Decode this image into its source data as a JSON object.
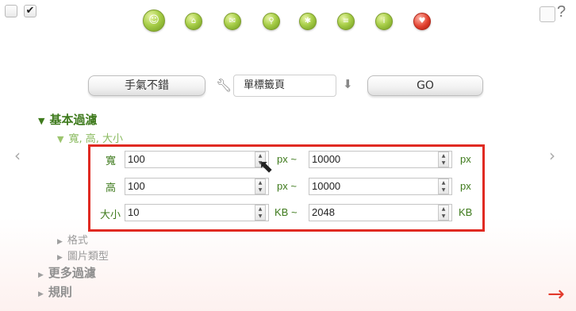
{
  "topbar": {
    "checkbox_unchecked": "",
    "checkbox_checked": "✔",
    "icons": [
      "smiley-icon",
      "home-icon",
      "mail-icon",
      "search-icon",
      "gear-icon",
      "list-icon",
      "info-icon",
      "heart-icon"
    ],
    "help": "?"
  },
  "toolbar": {
    "left_button": "手氣不錯",
    "middle_field": "單標籤頁",
    "right_button": "GO"
  },
  "tree": {
    "basic_filter": "基本過濾",
    "size_section": "寬, 高, 大小",
    "format": "格式",
    "image_type": "圖片類型",
    "more_filters": "更多過濾",
    "rules": "規則"
  },
  "filters": {
    "width": {
      "label": "寬",
      "min": "100",
      "max": "10000",
      "unit_min": "px ~",
      "unit_max": "px"
    },
    "height": {
      "label": "高",
      "min": "100",
      "max": "10000",
      "unit_min": "px ~",
      "unit_max": "px"
    },
    "size": {
      "label": "大小",
      "min": "10",
      "max": "2048",
      "unit_min": "KB ~",
      "unit_max": "KB"
    }
  },
  "nav": {
    "prev": "‹",
    "next": "›",
    "arrow": "→"
  },
  "colors": {
    "accent": "#3e7a1c",
    "highlight": "#e02a22"
  }
}
